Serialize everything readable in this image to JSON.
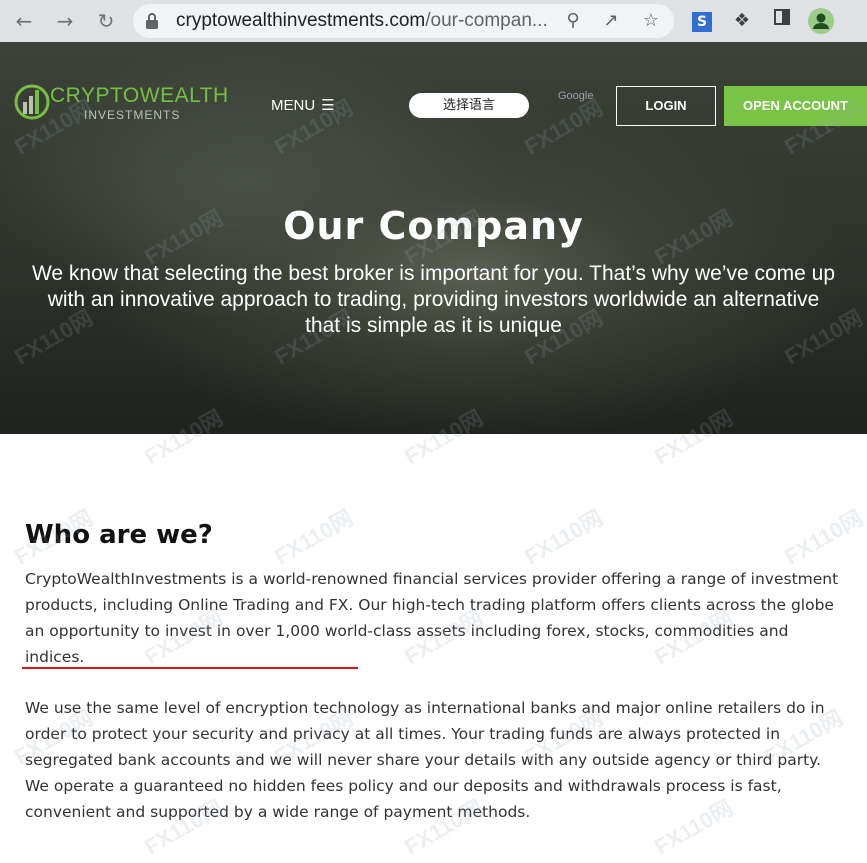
{
  "browser": {
    "url_domain": "cryptowealthinvestments.com",
    "url_path": "/our-compan...",
    "ext_label": "S"
  },
  "header": {
    "logo_main": "CRYPTOWEALTH",
    "logo_sub": "INVESTMENTS",
    "menu_label": "MENU",
    "language_label": "选择语言",
    "google_label": "Google",
    "login_label": "LOGIN",
    "open_account_label": "OPEN ACCOUNT"
  },
  "hero": {
    "title": "Our Company",
    "subtitle": "We know that selecting the best broker is important for you. That’s why we’ve come up with an innovative approach to trading, providing investors worldwide an alternative that is simple as it is unique"
  },
  "section": {
    "heading": "Who are we?",
    "paragraph1": "CryptoWealthInvestments is a world-renowned financial services provider offering a range of investment products, including Online Trading and FX. Our high-tech trading platform offers clients across the globe an opportunity to invest in over 1,000 world-class assets including forex, stocks, commodities and indices.",
    "paragraph2": "We use the same level of encryption technology as international banks and major online retailers do in order to protect your security and privacy at all times. Your trading funds are always protected in segregated bank accounts and we will never share your details with any outside agency or third party. We operate a guaranteed no hidden fees policy and our deposits and withdrawals process is fast, convenient and supported by a wide range of payment methods."
  },
  "colors": {
    "accent_green": "#79c346",
    "underline_red": "#e3121b"
  },
  "watermark": "FX110网"
}
